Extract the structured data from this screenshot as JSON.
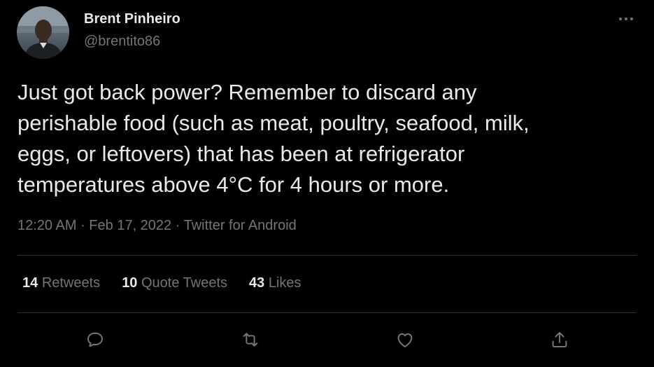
{
  "author": {
    "name": "Brent Pinheiro",
    "handle": "@brentito86"
  },
  "tweet": {
    "text": "Just got back power? Remember to discard any\nperishable food (such as meat, poultry, seafood, milk,\neggs, or leftovers) that has been at refrigerator\ntemperatures above 4°C for 4 hours or more.",
    "time": "12:20 AM",
    "date": "Feb 17, 2022",
    "source": "Twitter for Android",
    "separator": " · "
  },
  "stats": {
    "retweets_count": "14",
    "retweets_label": "Retweets",
    "quotes_count": "10",
    "quotes_label": "Quote Tweets",
    "likes_count": "43",
    "likes_label": "Likes"
  },
  "icons": {
    "more": "more-icon",
    "reply": "reply-icon",
    "retweet": "retweet-icon",
    "like": "like-icon",
    "share": "share-icon"
  },
  "colors": {
    "background": "#000000",
    "primary_text": "#e7e9ea",
    "secondary_text": "#71767b",
    "divider": "#2f3336"
  }
}
